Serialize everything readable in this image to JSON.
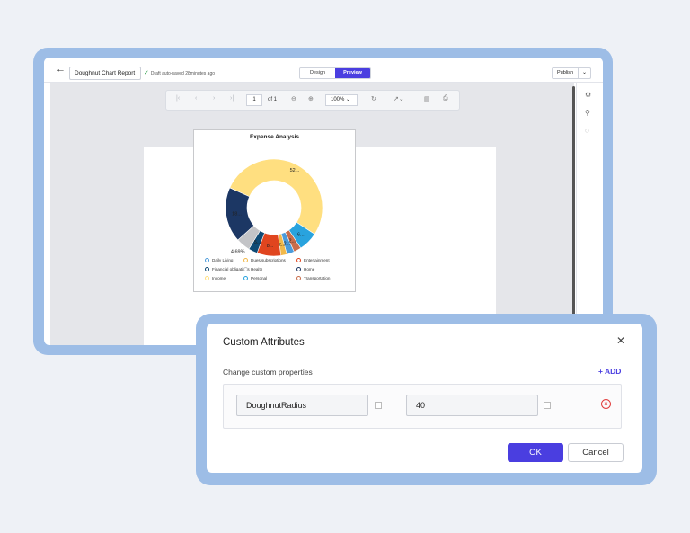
{
  "designer": {
    "report_name": "Doughnut Chart Report",
    "autosave": "Draft auto-saved 28minutes ago",
    "tabs": [
      "Design",
      "Preview"
    ],
    "active_tab": "Preview",
    "publish_label": "Publish"
  },
  "viewer_toolbar": {
    "page_value": "1",
    "page_of": "of 1",
    "zoom": "100%"
  },
  "chart_data": {
    "type": "doughnut",
    "title": "Expense Analysis",
    "data_labels": [
      "52...",
      "6...",
      "2...",
      "2...",
      "2...",
      "8...",
      "5...",
      "4.69%",
      "18..."
    ],
    "slices": [
      {
        "name": "Income",
        "value": 52.5,
        "color": "#ffdf80"
      },
      {
        "name": "Personal",
        "value": 6.5,
        "color": "#29a3de"
      },
      {
        "name": "Transportation",
        "value": 2.5,
        "color": "#c86d4c"
      },
      {
        "name": "Daily Living",
        "value": 2.5,
        "color": "#4b9bdb"
      },
      {
        "name": "Dues/subscriptions",
        "value": 2.0,
        "color": "#f2b94a"
      },
      {
        "name": "Entertainment",
        "value": 8.0,
        "color": "#e0451f"
      },
      {
        "name": "Financial obligations",
        "value": 3.0,
        "color": "#0e4a75"
      },
      {
        "name": "Health",
        "value": 4.69,
        "color": "#c3c4c7"
      },
      {
        "name": "Home",
        "value": 18.31,
        "color": "#1c3764"
      }
    ],
    "legend": [
      {
        "label": "Daily Living",
        "color": "#4b9bdb"
      },
      {
        "label": "Dues/subscriptions",
        "color": "#f2b94a"
      },
      {
        "label": "Entertainment",
        "color": "#e0451f"
      },
      {
        "label": "Financial obligations",
        "color": "#0e4a75"
      },
      {
        "label": "Health",
        "color": "#c3c4c7"
      },
      {
        "label": "Home",
        "color": "#1c3764"
      },
      {
        "label": "Income",
        "color": "#ffdf80"
      },
      {
        "label": "Personal",
        "color": "#29a3de"
      },
      {
        "label": "Transportation",
        "color": "#c86d4c"
      }
    ]
  },
  "dialog": {
    "title": "Custom Attributes",
    "subtitle": "Change custom properties",
    "add_label": "+ ADD",
    "attr_name": "DoughnutRadius",
    "attr_value": "40",
    "ok_label": "OK",
    "cancel_label": "Cancel"
  }
}
